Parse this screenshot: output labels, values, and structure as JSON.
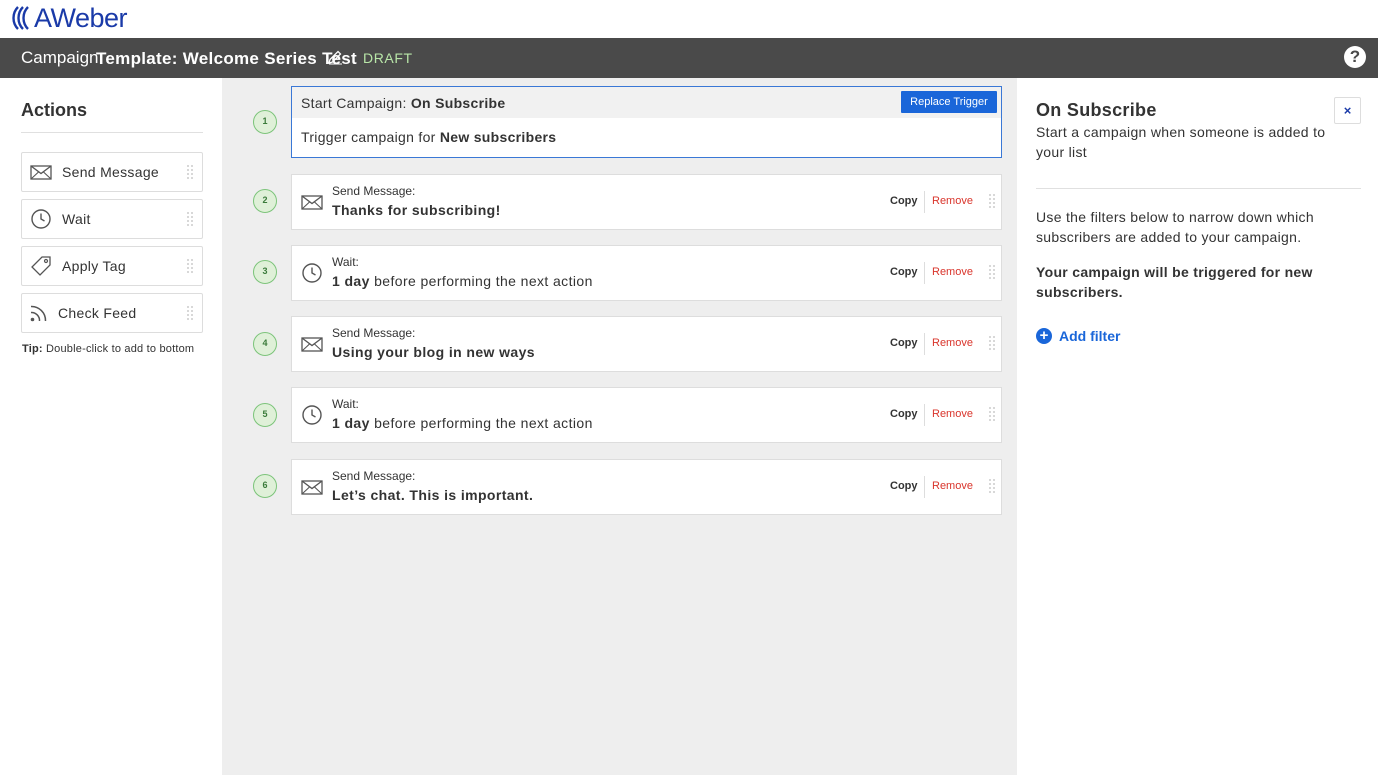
{
  "brand": {
    "logo_text": "AWeber",
    "brand_color": "#1a3aa8"
  },
  "campaign_bar": {
    "prefix": "Campaign",
    "name": "Template: Welcome Series Test",
    "status": "DRAFT",
    "edit_icon": "pencil-icon",
    "help_label": "?"
  },
  "actions": {
    "title": "Actions",
    "items": [
      {
        "label": "Send Message",
        "icon": "envelope-icon"
      },
      {
        "label": "Wait",
        "icon": "clock-icon"
      },
      {
        "label": "Apply Tag",
        "icon": "tag-icon"
      },
      {
        "label": "Check Feed",
        "icon": "rss-icon"
      }
    ],
    "tip_bold": "Tip:",
    "tip_text": " Double-click to add to bottom"
  },
  "trigger": {
    "number": "1",
    "head_prefix": "Start Campaign: ",
    "head_value": "On Subscribe",
    "replace_label": "Replace Trigger",
    "body_prefix": "Trigger campaign for ",
    "body_value": "New subscribers"
  },
  "steps": [
    {
      "number": "2",
      "kind": "Send Message:",
      "detail_bold": "Thanks for subscribing!",
      "detail_rest": "",
      "icon": "envelope-icon"
    },
    {
      "number": "3",
      "kind": "Wait:",
      "detail_bold": "1 day",
      "detail_rest": " before performing the next action",
      "icon": "clock-icon"
    },
    {
      "number": "4",
      "kind": "Send Message:",
      "detail_bold": "Using your blog in new ways",
      "detail_rest": "",
      "icon": "envelope-icon"
    },
    {
      "number": "5",
      "kind": "Wait:",
      "detail_bold": "1 day",
      "detail_rest": " before performing the next action",
      "icon": "clock-icon"
    },
    {
      "number": "6",
      "kind": "Send Message:",
      "detail_bold": "Let’s chat. This is important.",
      "detail_rest": "",
      "icon": "envelope-icon"
    }
  ],
  "step_actions": {
    "copy": "Copy",
    "remove": "Remove"
  },
  "panel": {
    "title": "On Subscribe",
    "close_label": "×",
    "description": "Start a campaign when someone is added to your list",
    "filter_text": "Use the filters below to narrow down which subscribers are added to your campaign.",
    "trigger_note": "Your campaign will be triggered for new subscribers.",
    "add_filter_label": "Add filter"
  },
  "colors": {
    "campaign_bar": "#4a4a4a",
    "draft": "#b8e6a8",
    "accent": "#1a66d9",
    "remove": "#d9342b",
    "step_badge": "#dff0d8"
  }
}
